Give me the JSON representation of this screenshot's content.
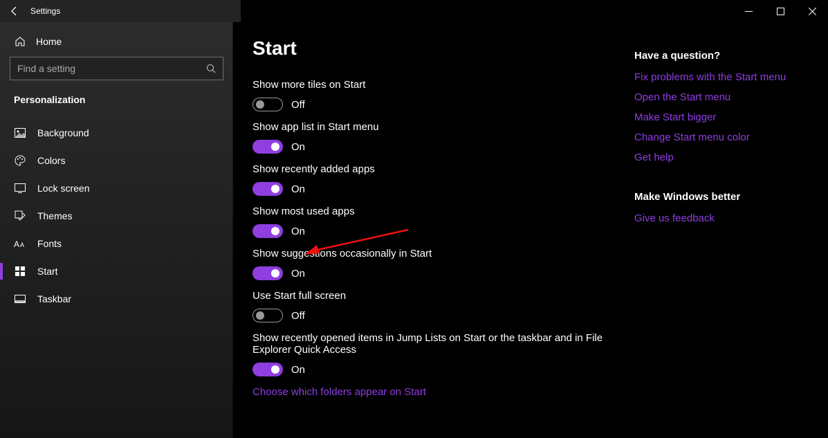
{
  "window": {
    "title": "Settings"
  },
  "sidebar": {
    "home_label": "Home",
    "search_placeholder": "Find a setting",
    "section": "Personalization",
    "items": [
      {
        "label": "Background",
        "icon": "image-icon",
        "selected": false
      },
      {
        "label": "Colors",
        "icon": "palette-icon",
        "selected": false
      },
      {
        "label": "Lock screen",
        "icon": "lockscreen-icon",
        "selected": false
      },
      {
        "label": "Themes",
        "icon": "themes-icon",
        "selected": false
      },
      {
        "label": "Fonts",
        "icon": "fonts-icon",
        "selected": false
      },
      {
        "label": "Start",
        "icon": "start-icon",
        "selected": true
      },
      {
        "label": "Taskbar",
        "icon": "taskbar-icon",
        "selected": false
      }
    ]
  },
  "page": {
    "title": "Start",
    "settings": [
      {
        "label": "Show more tiles on Start",
        "on": false,
        "state_text": "Off"
      },
      {
        "label": "Show app list in Start menu",
        "on": true,
        "state_text": "On"
      },
      {
        "label": "Show recently added apps",
        "on": true,
        "state_text": "On"
      },
      {
        "label": "Show most used apps",
        "on": true,
        "state_text": "On"
      },
      {
        "label": "Show suggestions occasionally in Start",
        "on": true,
        "state_text": "On"
      },
      {
        "label": "Use Start full screen",
        "on": false,
        "state_text": "Off"
      },
      {
        "label": "Show recently opened items in Jump Lists on Start or the taskbar and in File Explorer Quick Access",
        "on": true,
        "state_text": "On"
      }
    ],
    "footer_link": "Choose which folders appear on Start"
  },
  "aside": {
    "question_header": "Have a question?",
    "question_links": [
      "Fix problems with the Start menu",
      "Open the Start menu",
      "Make Start bigger",
      "Change Start menu color",
      "Get help"
    ],
    "feedback_header": "Make Windows better",
    "feedback_link": "Give us feedback"
  }
}
